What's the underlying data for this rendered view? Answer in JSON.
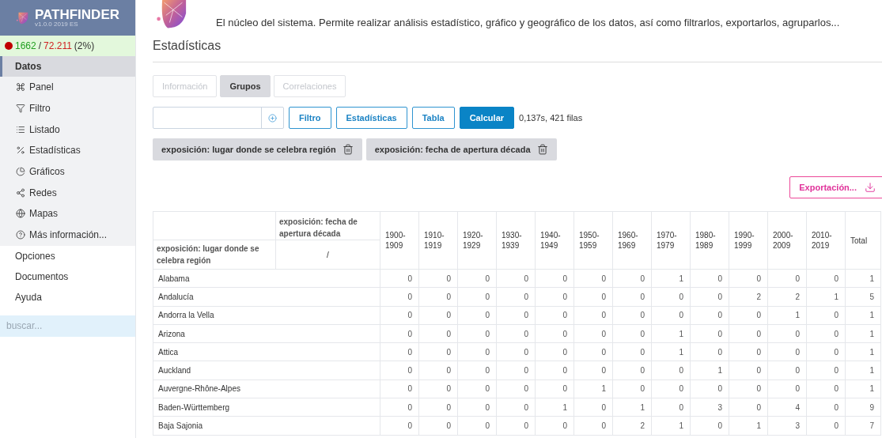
{
  "sidebar": {
    "app_name": "PATHFINDER",
    "version": "v1.0.0 2019 ES",
    "status": {
      "count": "1662",
      "separator": "/",
      "total": "72.211",
      "percent": "(2%)"
    },
    "sections": [
      {
        "label": "Datos",
        "selected": true,
        "children": [
          {
            "label": "Panel"
          },
          {
            "label": "Filtro"
          },
          {
            "label": "Listado"
          },
          {
            "label": "Estadísticas"
          },
          {
            "label": "Gráficos"
          },
          {
            "label": "Redes"
          },
          {
            "label": "Mapas"
          },
          {
            "label": "Más información..."
          }
        ]
      },
      {
        "label": "Opciones",
        "selected": false
      },
      {
        "label": "Documentos",
        "selected": false
      },
      {
        "label": "Ayuda",
        "selected": false
      }
    ],
    "search": {
      "placeholder": "buscar..."
    }
  },
  "main": {
    "description": "El núcleo del sistema. Permite realizar análisis estadístico, gráfico y geográfico de los datos, así como filtrarlos, exportarlos, agruparlos...",
    "section_title": "Estadísticas",
    "tabs": [
      {
        "label": "Información",
        "selected": false
      },
      {
        "label": "Grupos",
        "selected": true
      },
      {
        "label": "Correlaciones",
        "selected": false
      }
    ],
    "toolbar": {
      "buttons": [
        {
          "label": "Filtro",
          "kind": "outline"
        },
        {
          "label": "Estadísticas",
          "kind": "outline"
        },
        {
          "label": "Tabla",
          "kind": "outline"
        },
        {
          "label": "Calcular",
          "kind": "primary"
        }
      ],
      "timing": "0,137s, 421 filas"
    },
    "groups": [
      "exposición: lugar donde se celebra región",
      "exposición: fecha de apertura década"
    ],
    "export_button": "Exportación...",
    "table": {
      "column_group_header": "exposición: fecha de apertura década",
      "row_group_header": "exposición: lugar donde se celebra región",
      "divider": "/",
      "columns": [
        "1900-\n1909",
        "1910-\n1919",
        "1920-\n1929",
        "1930-\n1939",
        "1940-\n1949",
        "1950-\n1959",
        "1960-\n1969",
        "1970-\n1979",
        "1980-\n1989",
        "1990-\n1999",
        "2000-\n2009",
        "2010-\n2019",
        "Total"
      ],
      "rows": [
        {
          "label": "Alabama",
          "values": [
            "0",
            "0",
            "0",
            "0",
            "0",
            "0",
            "0",
            "1",
            "0",
            "0",
            "0",
            "0",
            "1"
          ]
        },
        {
          "label": "Andalucía",
          "values": [
            "0",
            "0",
            "0",
            "0",
            "0",
            "0",
            "0",
            "0",
            "0",
            "2",
            "2",
            "1",
            "5"
          ]
        },
        {
          "label": "Andorra la Vella",
          "values": [
            "0",
            "0",
            "0",
            "0",
            "0",
            "0",
            "0",
            "0",
            "0",
            "0",
            "1",
            "0",
            "1"
          ]
        },
        {
          "label": "Arizona",
          "values": [
            "0",
            "0",
            "0",
            "0",
            "0",
            "0",
            "0",
            "1",
            "0",
            "0",
            "0",
            "0",
            "1"
          ]
        },
        {
          "label": "Attica",
          "values": [
            "0",
            "0",
            "0",
            "0",
            "0",
            "0",
            "0",
            "1",
            "0",
            "0",
            "0",
            "0",
            "1"
          ]
        },
        {
          "label": "Auckland",
          "values": [
            "0",
            "0",
            "0",
            "0",
            "0",
            "0",
            "0",
            "0",
            "1",
            "0",
            "0",
            "0",
            "1"
          ]
        },
        {
          "label": "Auvergne-Rhône-Alpes",
          "values": [
            "0",
            "0",
            "0",
            "0",
            "0",
            "1",
            "0",
            "0",
            "0",
            "0",
            "0",
            "0",
            "1"
          ]
        },
        {
          "label": "Baden-Württemberg",
          "values": [
            "0",
            "0",
            "0",
            "0",
            "1",
            "0",
            "1",
            "0",
            "3",
            "0",
            "4",
            "0",
            "9"
          ]
        },
        {
          "label": "Baja Sajonia",
          "values": [
            "0",
            "0",
            "0",
            "0",
            "0",
            "0",
            "2",
            "1",
            "0",
            "1",
            "3",
            "0",
            "7"
          ]
        }
      ]
    }
  }
}
